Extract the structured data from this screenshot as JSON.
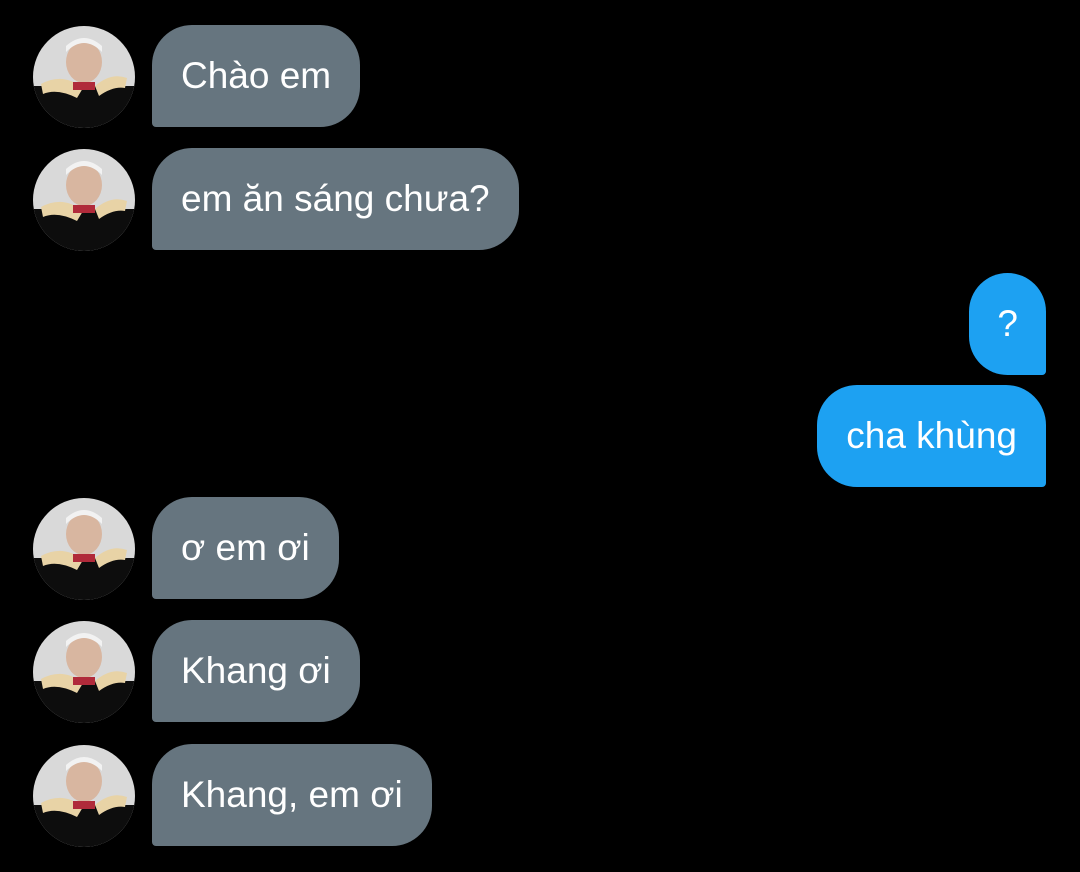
{
  "conversation": {
    "messages": [
      {
        "direction": "incoming",
        "text": "Chào em"
      },
      {
        "direction": "incoming",
        "text": "em ăn sáng chưa?"
      },
      {
        "direction": "outgoing",
        "text": "?"
      },
      {
        "direction": "outgoing",
        "text": "cha khùng"
      },
      {
        "direction": "incoming",
        "text": "ơ em ơi"
      },
      {
        "direction": "incoming",
        "text": "Khang ơi"
      },
      {
        "direction": "incoming",
        "text": "Khang, em ơi"
      }
    ]
  },
  "colors": {
    "background": "#000000",
    "incoming_bubble": "#66757f",
    "outgoing_bubble": "#1da1f2",
    "bubble_text": "#ffffff"
  },
  "icons": {
    "contact_avatar": "contact-avatar-photo"
  }
}
